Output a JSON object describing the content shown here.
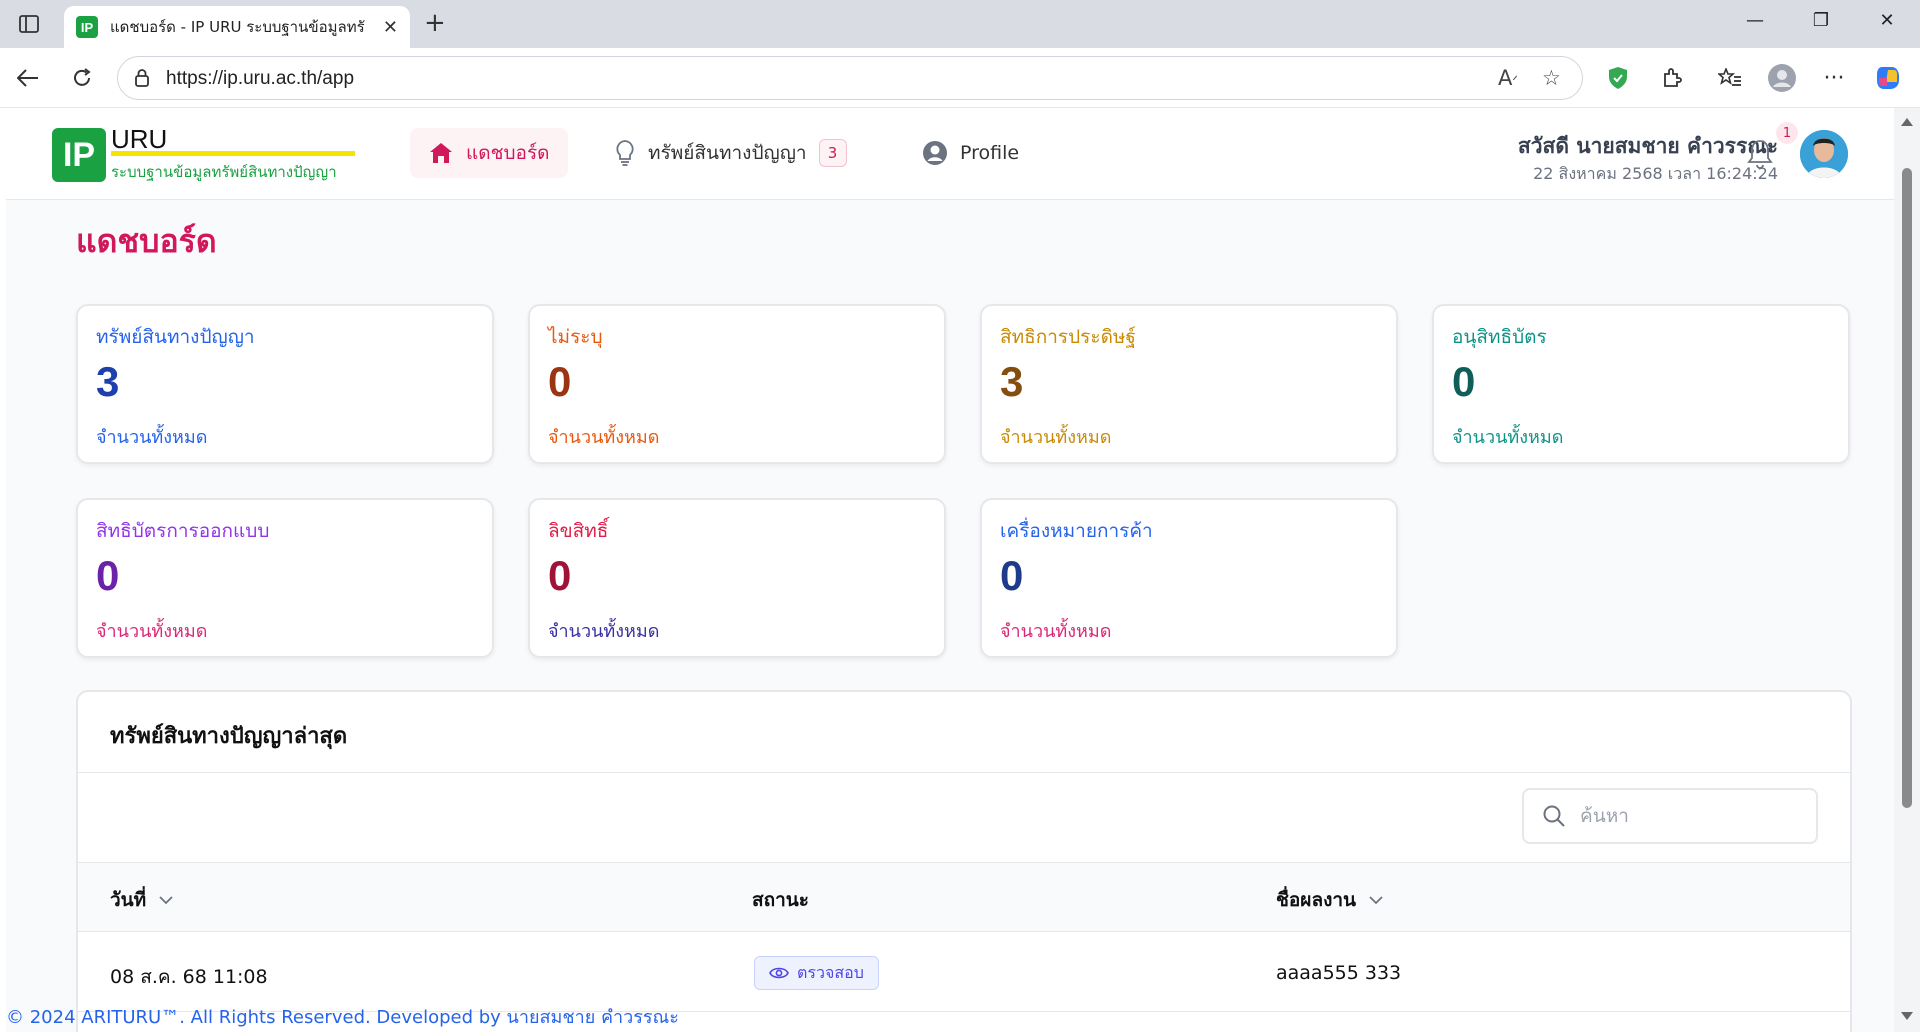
{
  "browser": {
    "tab_title": "แดชบอร์ด - IP URU ระบบฐานข้อมูลทรั",
    "tab_favicon": "IP",
    "url": "https://ip.uru.ac.th/app"
  },
  "header": {
    "logo_mark": "IP",
    "logo_name": "URU",
    "logo_subtitle": "ระบบฐานข้อมูลทรัพย์สินทางปัญญา",
    "nav": [
      {
        "label": "แดชบอร์ด",
        "icon": "home-icon"
      },
      {
        "label": "ทรัพย์สินทางปัญญา",
        "icon": "lightbulb-icon",
        "badge": "3"
      },
      {
        "label": "Profile",
        "icon": "user-circle-icon"
      }
    ],
    "greeting": "สวัสดี นายสมชาย คำวรรณะ",
    "datetime": "22 สิงหาคม 2568 เวลา 16:24:24",
    "notification_count": "1"
  },
  "page_title": "แดชบอร์ด",
  "stats": [
    {
      "label": "ทรัพย์สินทางปัญญา",
      "value": "3",
      "foot": "จำนวนทั้งหมด",
      "label_color": "#2563eb",
      "value_color": "#1e40af",
      "foot_color": "#2563eb"
    },
    {
      "label": "ไม่ระบุ",
      "value": "0",
      "foot": "จำนวนทั้งหมด",
      "label_color": "#ea580c",
      "value_color": "#9a3412",
      "foot_color": "#ea580c"
    },
    {
      "label": "สิทธิการประดิษฐ์",
      "value": "3",
      "foot": "จำนวนทั้งหมด",
      "label_color": "#ca8a04",
      "value_color": "#854d0e",
      "foot_color": "#ca8a04"
    },
    {
      "label": "อนุสิทธิบัตร",
      "value": "0",
      "foot": "จำนวนทั้งหมด",
      "label_color": "#0d9488",
      "value_color": "#115e59",
      "foot_color": "#0d9488"
    },
    {
      "label": "สิทธิบัตรการออกแบบ",
      "value": "0",
      "foot": "จำนวนทั้งหมด",
      "label_color": "#9333ea",
      "value_color": "#6b21a8",
      "foot_color": "#db2777"
    },
    {
      "label": "ลิขสิทธิ์",
      "value": "0",
      "foot": "จำนวนทั้งหมด",
      "label_color": "#e11d48",
      "value_color": "#9f1239",
      "foot_color": "#3730a3"
    },
    {
      "label": "เครื่องหมายการค้า",
      "value": "0",
      "foot": "จำนวนทั้งหมด",
      "label_color": "#2563eb",
      "value_color": "#1e3a8a",
      "foot_color": "#db2777"
    }
  ],
  "latest": {
    "title": "ทรัพย์สินทางปัญญาล่าสุด",
    "search_placeholder": "ค้นหา",
    "columns": [
      "วันที่",
      "สถานะ",
      "ชื่อผลงาน"
    ],
    "rows": [
      {
        "date": "08 ส.ค. 68 11:08",
        "status": "ตรวจสอบ",
        "name": "aaaa555 333"
      }
    ]
  },
  "footer": "© 2024 ARITURU™. All Rights Reserved. Developed by นายสมชาย คำวรรณะ"
}
